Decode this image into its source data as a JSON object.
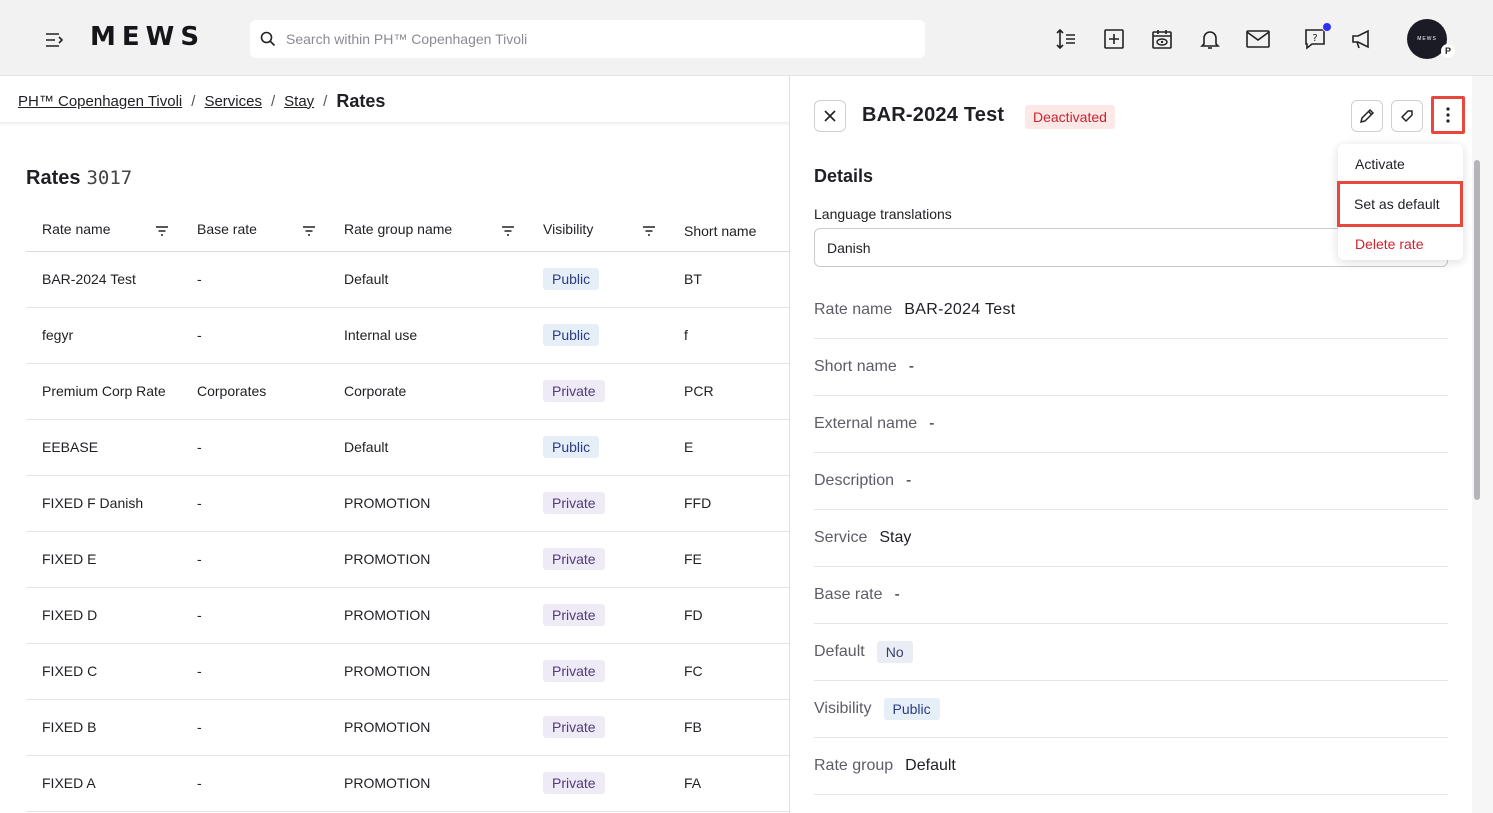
{
  "topbar": {
    "logo": "MEWS",
    "search_placeholder": "Search within PH™ Copenhagen Tivoli",
    "icons": [
      "menu-collapse-icon",
      "sort-lines-icon",
      "plus-square-icon",
      "calendar-eye-icon",
      "bell-icon",
      "mail-icon",
      "help-chat-icon",
      "megaphone-icon"
    ],
    "avatar_text": "MEWS",
    "avatar_badge": "P",
    "notification_dot_color": "#2f2ffa"
  },
  "breadcrumb": {
    "items": [
      "PH™ Copenhagen Tivoli",
      "Services",
      "Stay"
    ],
    "separator": "/",
    "current": "Rates"
  },
  "rates": {
    "title": "Rates",
    "count": "3017",
    "columns": [
      "Rate name",
      "Base rate",
      "Rate group name",
      "Visibility",
      "Short name"
    ],
    "rows": [
      {
        "name": "BAR-2024 Test",
        "base": "-",
        "group": "Default",
        "visibility": "Public",
        "short": "BT"
      },
      {
        "name": "fegyr",
        "base": "-",
        "group": "Internal use",
        "visibility": "Public",
        "short": "f"
      },
      {
        "name": "Premium Corp Rate",
        "base": "Corporates",
        "group": "Corporate",
        "visibility": "Private",
        "short": "PCR"
      },
      {
        "name": "EEBASE",
        "base": "-",
        "group": "Default",
        "visibility": "Public",
        "short": "E"
      },
      {
        "name": "FIXED F Danish",
        "base": "-",
        "group": "PROMOTION",
        "visibility": "Private",
        "short": "FFD"
      },
      {
        "name": "FIXED E",
        "base": "-",
        "group": "PROMOTION",
        "visibility": "Private",
        "short": "FE"
      },
      {
        "name": "FIXED D",
        "base": "-",
        "group": "PROMOTION",
        "visibility": "Private",
        "short": "FD"
      },
      {
        "name": "FIXED C",
        "base": "-",
        "group": "PROMOTION",
        "visibility": "Private",
        "short": "FC"
      },
      {
        "name": "FIXED B",
        "base": "-",
        "group": "PROMOTION",
        "visibility": "Private",
        "short": "FB"
      },
      {
        "name": "FIXED A",
        "base": "-",
        "group": "PROMOTION",
        "visibility": "Private",
        "short": "FA"
      }
    ]
  },
  "detail": {
    "title": "BAR-2024 Test",
    "status": "Deactivated",
    "menu": {
      "activate": "Activate",
      "set_default": "Set as default",
      "delete": "Delete rate"
    },
    "section_title": "Details",
    "language_label": "Language translations",
    "language_value": "Danish",
    "fields": {
      "rate_name": {
        "label": "Rate name",
        "value": "BAR-2024 Test"
      },
      "short_name": {
        "label": "Short name",
        "value": "-"
      },
      "external_name": {
        "label": "External name",
        "value": "-"
      },
      "description": {
        "label": "Description",
        "value": "-"
      },
      "service": {
        "label": "Service",
        "value": "Stay"
      },
      "base_rate": {
        "label": "Base rate",
        "value": "-"
      },
      "default": {
        "label": "Default",
        "value": "No"
      },
      "visibility": {
        "label": "Visibility",
        "value": "Public"
      },
      "rate_group": {
        "label": "Rate group",
        "value": "Default"
      }
    },
    "highlight_color": "#e8473d"
  }
}
